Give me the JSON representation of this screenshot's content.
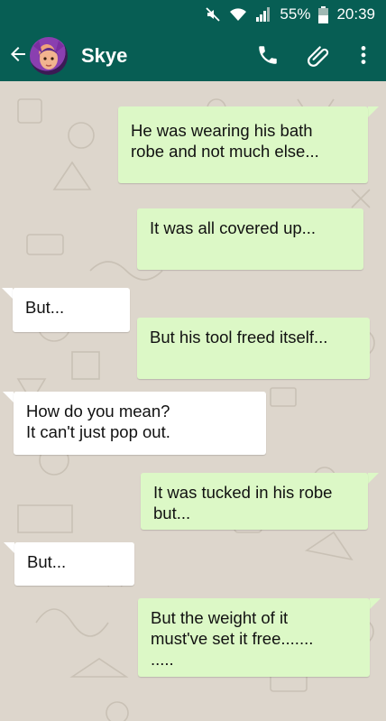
{
  "status_bar": {
    "battery_percent": "55%",
    "time": "20:39"
  },
  "header": {
    "contact_name": "Skye",
    "icons": [
      "back-arrow-icon",
      "phone-icon",
      "paperclip-icon",
      "more-vert-icon"
    ]
  },
  "colors": {
    "header": "#075e54",
    "outgoing_bubble": "#dcf8c6",
    "incoming_bubble": "#ffffff",
    "wallpaper": "#ddd6cc"
  },
  "messages": [
    {
      "direction": "out",
      "text": "He was wearing his bath\nrobe and not much else..."
    },
    {
      "direction": "out",
      "text": "It was all covered up..."
    },
    {
      "direction": "in",
      "text": "But..."
    },
    {
      "direction": "out",
      "text": "But his tool freed itself..."
    },
    {
      "direction": "in",
      "text": "How do you mean?\nIt can't just pop out."
    },
    {
      "direction": "out",
      "text": "It was tucked in his robe\nbut..."
    },
    {
      "direction": "in",
      "text": "But..."
    },
    {
      "direction": "out",
      "text": "But the weight of it\nmust've set it free.......\n....."
    }
  ]
}
